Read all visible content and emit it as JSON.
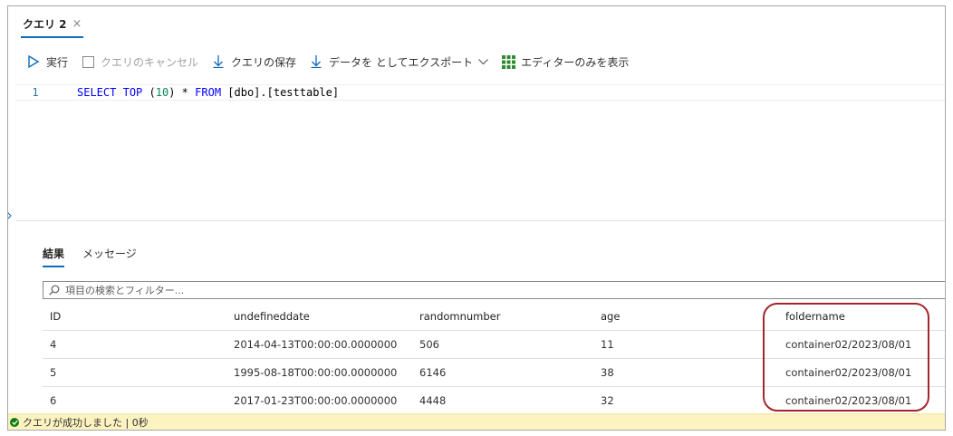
{
  "tab": {
    "title": "クエリ 2",
    "close_glyph": "×"
  },
  "toolbar": {
    "run": "実行",
    "cancel": "クエリのキャンセル",
    "save": "クエリの保存",
    "export": "データを としてエクスポート",
    "editor_only": "エディターのみを表示"
  },
  "editor": {
    "line_number": "1",
    "tokens": {
      "k1": "SELECT",
      "k2": "TOP",
      "p1": "(",
      "n1": "10",
      "p2": ")",
      "op": "*",
      "k3": "FROM",
      "rest": "[dbo].[testtable]"
    }
  },
  "results": {
    "tabs": [
      "結果",
      "メッセージ"
    ],
    "filter_placeholder": "項目の検索とフィルター...",
    "columns": [
      "ID",
      "undefineddate",
      "randomnumber",
      "age",
      "foldername"
    ],
    "rows": [
      [
        "4",
        "2014-04-13T00:00:00.0000000",
        "506",
        "11",
        "container02/2023/08/01"
      ],
      [
        "5",
        "1995-08-18T00:00:00.0000000",
        "6146",
        "38",
        "container02/2023/08/01"
      ],
      [
        "6",
        "2017-01-23T00:00:00.0000000",
        "4448",
        "32",
        "container02/2023/08/01"
      ]
    ]
  },
  "status": {
    "message": "クエリが成功しました | 0秒"
  },
  "colors": {
    "accent": "#0f6cbd",
    "annotation": "#a4262c",
    "status_bg": "#fcf3c0",
    "success": "#107c10"
  }
}
